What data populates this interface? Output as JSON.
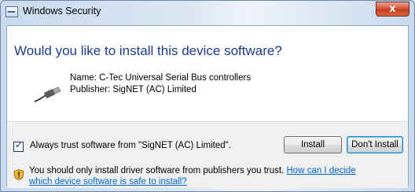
{
  "window": {
    "title": "Windows Security",
    "close_glyph": "x"
  },
  "main": {
    "headline": "Would you like to install this device software?",
    "device": {
      "icon": "usb-cable-icon",
      "name_line": "Name: C-Tec Universal Serial Bus controllers",
      "publisher_line": "Publisher: SigNET (AC) Limited"
    }
  },
  "footer": {
    "always_trust": {
      "checked": true,
      "label": "Always trust software from \"SigNET (AC) Limited\"."
    },
    "install_label": "Install",
    "dont_install_label": "Don't Install",
    "warning": {
      "icon": "shield-warning-icon",
      "text": "You should only install driver software from publishers you trust.",
      "link_part1": "How can I decide",
      "link_part2": "which device software is safe to install?"
    }
  },
  "colors": {
    "headline": "#1a3c8c",
    "link": "#0066cc",
    "close": "#c53b20"
  }
}
